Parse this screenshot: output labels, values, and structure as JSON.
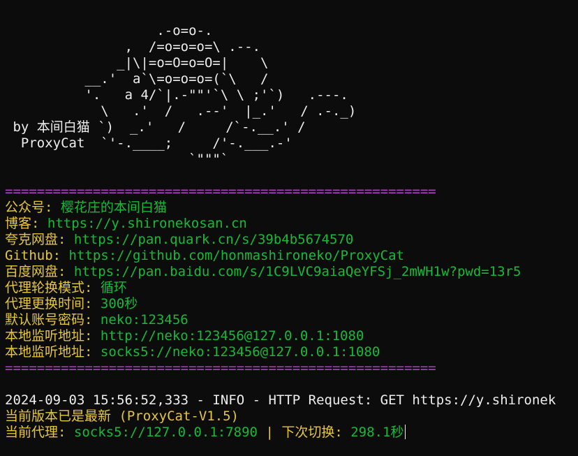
{
  "ascii_art": [
    "                   .-o=o-.",
    "               ,  /=o=o=o=\\ .--.",
    "              _|\\|=o=O=o=O=|    \\",
    "          __.'  a`\\=o=o=o=(`\\   /",
    "          '.   a 4/`|.-\"\"'`\\ \\ ;'`)   .---.",
    "            \\   .'  /   .--'  |_.'   / .-._)",
    " by 本间白猫 `)  _.'   /     /`-.__.' /",
    "  ProxyCat  `'-.____;     /'-.___.-'",
    "                       `\"\"\"`"
  ],
  "separator": "======================================================",
  "info": [
    {
      "label": "公众号: ",
      "value": "樱花庄的本间白猫"
    },
    {
      "label": "博客: ",
      "value": "https://y.shironekosan.cn"
    },
    {
      "label": "夸克网盘: ",
      "value": "https://pan.quark.cn/s/39b4b5674570"
    },
    {
      "label": "Github: ",
      "value": "https://github.com/honmashironeko/ProxyCat"
    },
    {
      "label": "百度网盘: ",
      "value": "https://pan.baidu.com/s/1C9LVC9aiaQeYFSj_2mWH1w?pwd=13r5"
    },
    {
      "label": "代理轮换模式: ",
      "value": "循环"
    },
    {
      "label": "代理更换时间: ",
      "value": "300秒"
    },
    {
      "label": "默认账号密码: ",
      "value": "neko:123456"
    },
    {
      "label": "本地监听地址: ",
      "value": "http://neko:123456@127.0.0.1:1080"
    },
    {
      "label": "本地监听地址: ",
      "value": "socks5://neko:123456@127.0.0.1:1080"
    }
  ],
  "log": {
    "request_line": "2024-09-03 15:56:52,333 - INFO - HTTP Request: GET https://y.shironek",
    "version_line": "当前版本已是最新 (ProxyCat-V1.5)",
    "proxy_label": "当前代理: ",
    "proxy_value": "socks5://127.0.0.1:7890",
    "divider": " | ",
    "next_label": "下次切换: ",
    "next_value": "298.1秒"
  }
}
